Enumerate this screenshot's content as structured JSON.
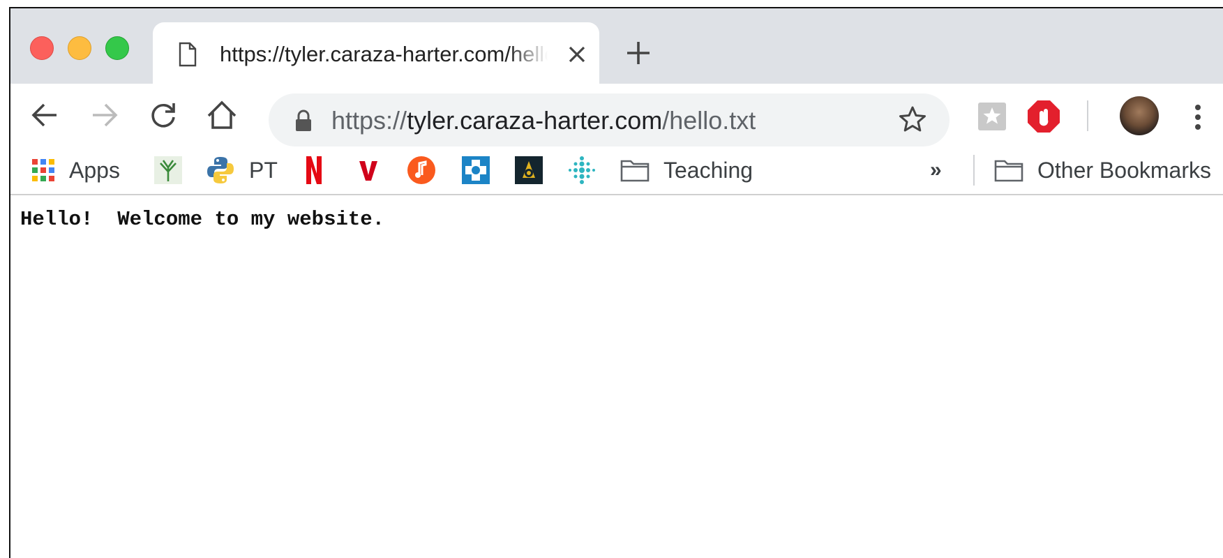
{
  "tab": {
    "title": "https://tyler.caraza-harter.com/hello.txt",
    "icon": "page-icon"
  },
  "omnibox": {
    "scheme": "https://",
    "host": "tyler.caraza-harter.com",
    "path": "/hello.txt"
  },
  "bookmarks": {
    "items": [
      {
        "label": "Apps",
        "icon": "apps-grid-icon"
      },
      {
        "label": "",
        "icon": "plant-icon"
      },
      {
        "label": "PT",
        "icon": "python-icon"
      },
      {
        "label": "",
        "icon": "netflix-icon"
      },
      {
        "label": "",
        "icon": "vudu-icon"
      },
      {
        "label": "",
        "icon": "music-icon"
      },
      {
        "label": "",
        "icon": "health-icon"
      },
      {
        "label": "",
        "icon": "badge-icon"
      },
      {
        "label": "",
        "icon": "fitbit-icon"
      },
      {
        "label": "Teaching",
        "icon": "folder-icon"
      }
    ],
    "overflow": "»",
    "other": "Other Bookmarks"
  },
  "page": {
    "text": "Hello!  Welcome to my website."
  },
  "colors": {
    "tabbar": "#dee1e6",
    "omnibox": "#f1f3f4",
    "close": "#fc605c",
    "minimize": "#fdbc40",
    "maximize": "#34c84a"
  }
}
